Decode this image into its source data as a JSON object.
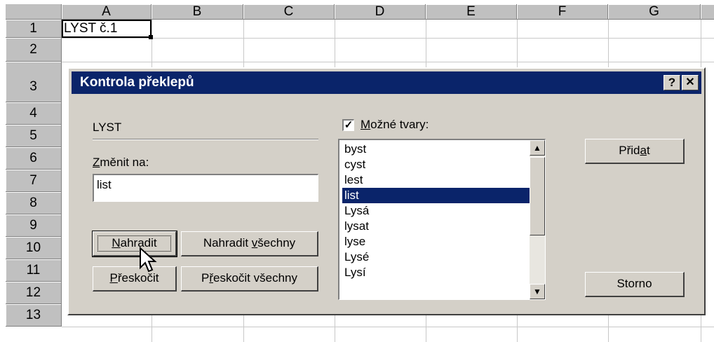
{
  "sheet": {
    "columns": [
      "A",
      "B",
      "C",
      "D",
      "E",
      "F",
      "G"
    ],
    "rows": [
      "1",
      "2",
      "3",
      "4",
      "5",
      "6",
      "7",
      "8",
      "9",
      "10",
      "11",
      "12",
      "13"
    ],
    "cell_a1": "LYST č.1"
  },
  "dialog": {
    "title": "Kontrola překlepů",
    "help_button": "?",
    "close_button": "✕",
    "not_in_dictionary": "LYST",
    "change_to_label": "Změnit na:",
    "change_to_value": "list",
    "suggestions_checkbox_label": "Možné tvary:",
    "suggestions_checked": true,
    "suggestions": [
      "byst",
      "cyst",
      "lest",
      "list",
      "Lysá",
      "lysat",
      "lyse",
      "Lysé",
      "Lysí"
    ],
    "selected_suggestion": "list",
    "buttons": {
      "replace": "Nahradit",
      "replace_all": "Nahradit všechny",
      "skip": "Přeskočit",
      "skip_all": "Přeskočit všechny",
      "add": "Přidat",
      "cancel": "Storno"
    }
  },
  "colors": {
    "titlebar": "#0a246a",
    "dialog_bg": "#d4d0c8",
    "selection": "#0a246a"
  }
}
